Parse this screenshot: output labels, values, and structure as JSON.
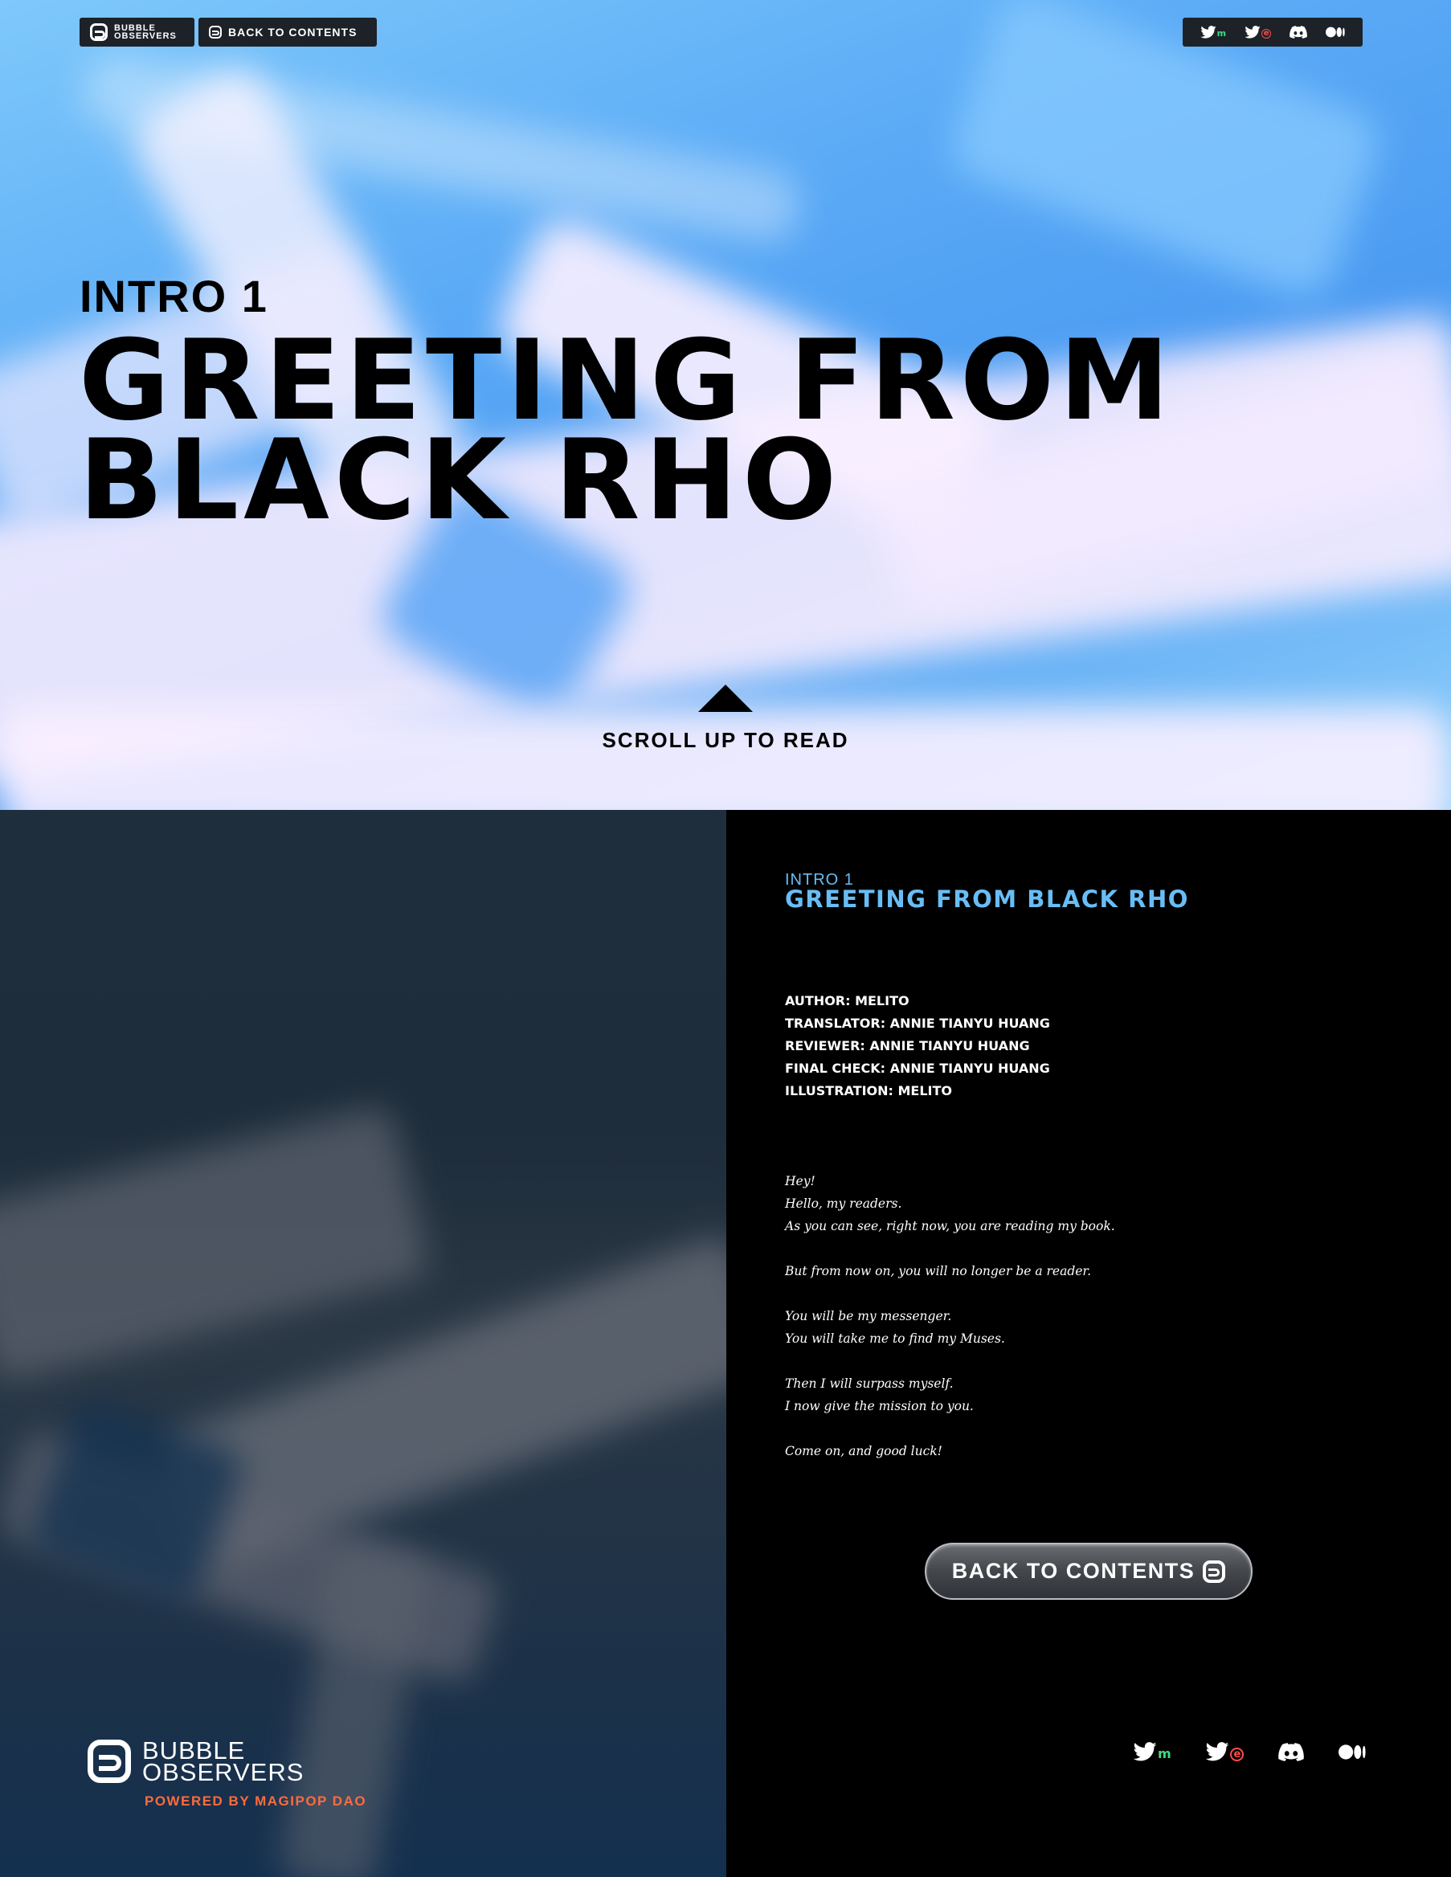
{
  "header": {
    "brand_line1": "BUBBLE",
    "brand_line2": "OBSERVERS",
    "back_label": "BACK TO CONTENTS",
    "social": [
      {
        "name": "twitter-m",
        "icon": "twitter-icon",
        "badge": "m"
      },
      {
        "name": "twitter-red",
        "icon": "twitter-icon",
        "badge": "e"
      },
      {
        "name": "discord",
        "icon": "discord-icon"
      },
      {
        "name": "medium",
        "icon": "medium-icon"
      }
    ]
  },
  "hero": {
    "chapter": "INTRO 1",
    "title_line1": "GREETING FROM",
    "title_line2": "BLACK RHO",
    "scroll_label": "SCROLL UP TO READ"
  },
  "article": {
    "chapter": "INTRO 1",
    "title": "GREETING FROM BLACK RHO",
    "credits": [
      "AUTHOR: MELITO",
      "TRANSLATOR: ANNIE TIANYU HUANG",
      "REVIEWER: ANNIE TIANYU HUANG",
      "FINAL CHECK: ANNIE TIANYU HUANG",
      "ILLUSTRATION: MELITO"
    ],
    "story": {
      "p1": [
        "Hey!",
        "Hello, my readers.",
        "As you can see, right now, you are reading my book."
      ],
      "p2": [
        "But from now on, you will no longer be a reader."
      ],
      "p3": [
        "You will be my messenger.",
        "You will take me to find my Muses."
      ],
      "p4": [
        "Then I will surpass myself.",
        "I now give the mission to you."
      ],
      "p5": [
        "Come on, and good luck!"
      ]
    },
    "back_button": "BACK TO CONTENTS"
  },
  "footer": {
    "brand_line1": "BUBBLE",
    "brand_line2": "OBSERVERS",
    "powered_by": "POWERED BY MAGIPOP DAO"
  },
  "colors": {
    "accent_blue": "#69bdf5",
    "powered_orange": "#ff6b3d",
    "badge_green": "#3ddc84",
    "badge_red": "#ff4b4b"
  }
}
